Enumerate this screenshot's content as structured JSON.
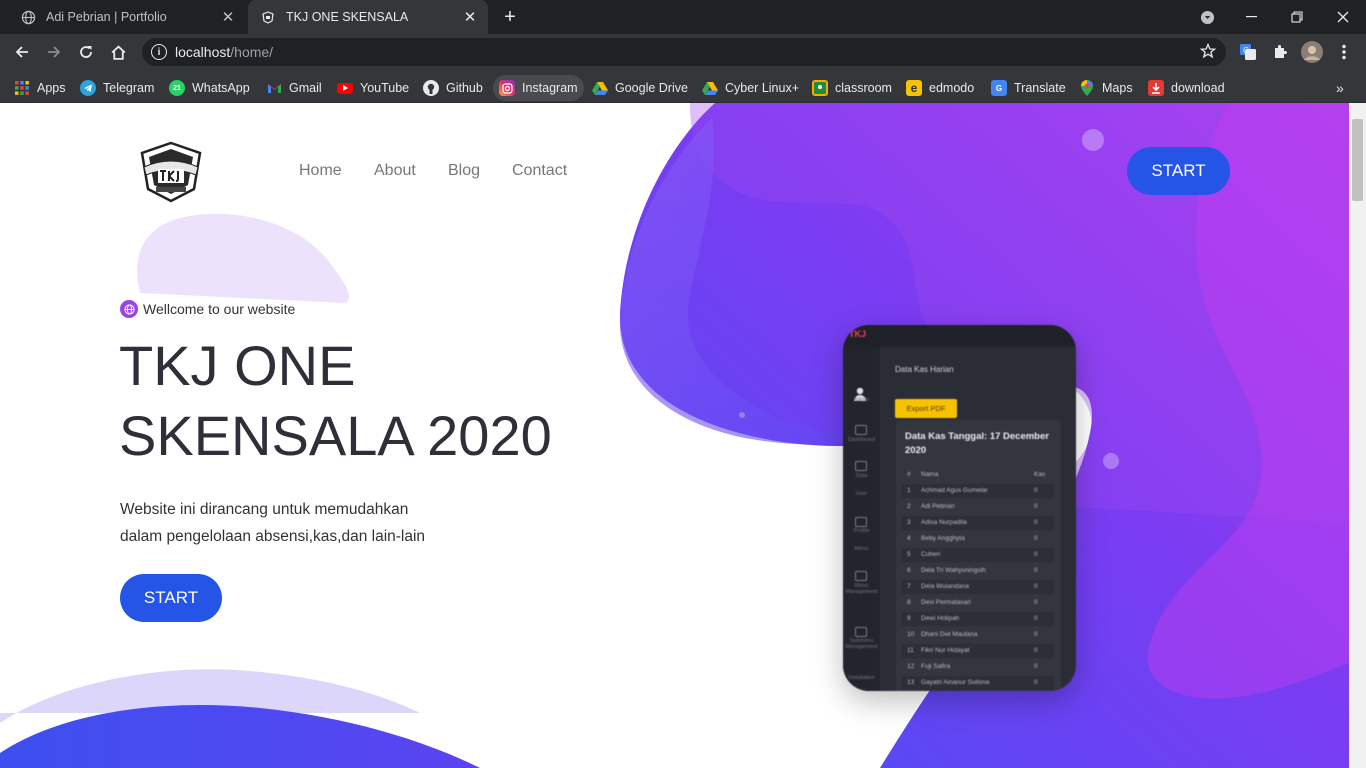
{
  "browser": {
    "tabs": [
      {
        "title": "Adi Pebrian | Portfolio",
        "active": false
      },
      {
        "title": "TKJ ONE SKENSALA",
        "active": true
      }
    ],
    "url_host": "localhost",
    "url_path": "/home/",
    "bookmarks": [
      {
        "label": "Apps",
        "icon": "apps-grid-icon"
      },
      {
        "label": "Telegram",
        "icon": "telegram-icon"
      },
      {
        "label": "WhatsApp",
        "icon": "whatsapp-icon"
      },
      {
        "label": "Gmail",
        "icon": "gmail-icon"
      },
      {
        "label": "YouTube",
        "icon": "youtube-icon"
      },
      {
        "label": "Github",
        "icon": "github-icon"
      },
      {
        "label": "Instagram",
        "icon": "instagram-icon"
      },
      {
        "label": "Google Drive",
        "icon": "google-drive-icon"
      },
      {
        "label": "Cyber Linux+",
        "icon": "google-drive-icon"
      },
      {
        "label": "classroom",
        "icon": "classroom-icon"
      },
      {
        "label": "edmodo",
        "icon": "edmodo-icon"
      },
      {
        "label": "Translate",
        "icon": "translate-icon"
      },
      {
        "label": "Maps",
        "icon": "maps-icon"
      },
      {
        "label": "download",
        "icon": "download-icon"
      }
    ]
  },
  "site": {
    "nav": {
      "home": "Home",
      "about": "About",
      "blog": "Blog",
      "contact": "Contact"
    },
    "start_top": "START",
    "welcome": "Wellcome to our website",
    "title_line1": "TKJ ONE",
    "title_line2": "SKENSALA 2020",
    "desc_line1": "Website ini dirancang untuk memudahkan",
    "desc_line2": "dalam pengelolaan absensi,kas,dan lain-lain",
    "start_hero": "START",
    "colors": {
      "accent": "#2455e6",
      "purple": "#8a3ff0",
      "violet": "#5b4cf5"
    }
  },
  "phone": {
    "brand": "TKJ",
    "header": "Data Kas Harian",
    "export_label": "Export PDF",
    "card_title": "Data Kas Tanggal: 17 December 2020",
    "col_no": "#",
    "col_name": "Nama",
    "col_kas": "Kas",
    "side": {
      "admin": "Admin",
      "dashboard": "Dashboard",
      "data": "Data",
      "user": "User",
      "profile": "Profile",
      "menu": "Menu",
      "menu_mgmt": "Menu Management",
      "submenu": "Submenu Management",
      "installation": "Installation"
    },
    "rows": [
      {
        "no": "1",
        "name": "Achmad Agus Gumelar",
        "kas": "0"
      },
      {
        "no": "2",
        "name": "Adi Pebrian",
        "kas": "0"
      },
      {
        "no": "3",
        "name": "Adisa Nurpadila",
        "kas": "0"
      },
      {
        "no": "4",
        "name": "Beby Angghyta",
        "kas": "0"
      },
      {
        "no": "5",
        "name": "Cuheri",
        "kas": "0"
      },
      {
        "no": "6",
        "name": "Dela Tri Wahyuningsih",
        "kas": "0"
      },
      {
        "no": "7",
        "name": "Dela Wulandana",
        "kas": "0"
      },
      {
        "no": "8",
        "name": "Desi Permatasari",
        "kas": "0"
      },
      {
        "no": "9",
        "name": "Dewi Holipah",
        "kas": "0"
      },
      {
        "no": "10",
        "name": "Dhani Dwi Maulana",
        "kas": "0"
      },
      {
        "no": "11",
        "name": "Fikri Nur Hidayat",
        "kas": "0"
      },
      {
        "no": "12",
        "name": "Fuji Safira",
        "kas": "0"
      },
      {
        "no": "13",
        "name": "Gayatri Ainanur Sutisna",
        "kas": "0"
      }
    ]
  }
}
